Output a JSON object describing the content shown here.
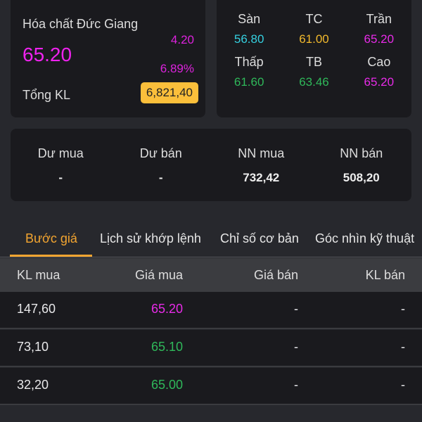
{
  "summary": {
    "name": "Hóa chất Đức Giang",
    "price": "65.20",
    "change": "4.20",
    "change_pct": "6.89%",
    "total_label": "Tổng KL",
    "total_value": "6,821,40"
  },
  "ref": [
    {
      "label": "Sàn",
      "value": "56.80",
      "color": "#35d0e0"
    },
    {
      "label": "TC",
      "value": "61.00",
      "color": "#f2b92c"
    },
    {
      "label": "Trần",
      "value": "65.20",
      "color": "#e82be8"
    },
    {
      "label": "Thấp",
      "value": "61.60",
      "color": "#2fb85a"
    },
    {
      "label": "TB",
      "value": "63.46",
      "color": "#2fb85a"
    },
    {
      "label": "Cao",
      "value": "65.20",
      "color": "#e82be8"
    }
  ],
  "stats": [
    {
      "label": "Dư mua",
      "value": "-"
    },
    {
      "label": "Dư bán",
      "value": "-"
    },
    {
      "label": "NN mua",
      "value": "732,42"
    },
    {
      "label": "NN bán",
      "value": "508,20"
    }
  ],
  "tabs": [
    "Bước giá",
    "Lịch sử khớp lệnh",
    "Chỉ số cơ bản",
    "Góc nhìn kỹ thuật"
  ],
  "table": {
    "headers": [
      "KL mua",
      "Giá mua",
      "Giá bán",
      "KL bán"
    ],
    "rows": [
      {
        "kl_mua": "147,60",
        "gia_mua": "65.20",
        "gia_ban": "-",
        "kl_ban": "-",
        "color": "#e82be8"
      },
      {
        "kl_mua": "73,10",
        "gia_mua": "65.10",
        "gia_ban": "-",
        "kl_ban": "-",
        "color": "#2fb85a"
      },
      {
        "kl_mua": "32,20",
        "gia_mua": "65.00",
        "gia_ban": "-",
        "kl_ban": "-",
        "color": "#2fb85a"
      }
    ]
  }
}
